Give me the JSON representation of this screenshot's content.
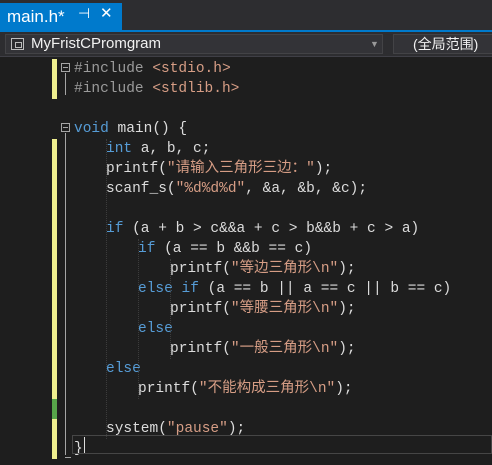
{
  "tab": {
    "title": "main.h*",
    "pin_glyph": "⊣",
    "close_glyph": "✕"
  },
  "nav": {
    "scope": "MyFristCPromgram",
    "member": "(全局范围)"
  },
  "code": [
    {
      "indent": 0,
      "fold": true,
      "change": "unsaved",
      "tokens": [
        [
          "p",
          "#include "
        ],
        [
          "i",
          "<stdio.h>"
        ]
      ]
    },
    {
      "indent": 0,
      "fold": false,
      "change": "unsaved",
      "tokens": [
        [
          "p",
          "#include "
        ],
        [
          "i",
          "<stdlib.h>"
        ]
      ]
    },
    {
      "indent": 0,
      "fold": false,
      "change": "none",
      "tokens": []
    },
    {
      "indent": 0,
      "fold": true,
      "change": "none",
      "tokens": [
        [
          "k",
          "void"
        ],
        [
          "f",
          " main() {"
        ]
      ]
    },
    {
      "indent": 1,
      "fold": false,
      "change": "unsaved",
      "tokens": [
        [
          "k",
          "int"
        ],
        [
          "f",
          " a, b, c;"
        ]
      ]
    },
    {
      "indent": 1,
      "fold": false,
      "change": "unsaved",
      "tokens": [
        [
          "f",
          "printf("
        ],
        [
          "s",
          "\"请输入三角形三边：\""
        ],
        [
          "f",
          ");"
        ]
      ]
    },
    {
      "indent": 1,
      "fold": false,
      "change": "unsaved",
      "tokens": [
        [
          "f",
          "scanf_s("
        ],
        [
          "s",
          "\"%d%d%d\""
        ],
        [
          "f",
          ", &a, &b, &c);"
        ]
      ]
    },
    {
      "indent": 0,
      "fold": false,
      "change": "unsaved",
      "tokens": []
    },
    {
      "indent": 1,
      "fold": false,
      "change": "unsaved",
      "tokens": [
        [
          "k",
          "if"
        ],
        [
          "f",
          " (a + b > c&&a + c > b&&b + c > a)"
        ]
      ]
    },
    {
      "indent": 2,
      "fold": false,
      "change": "unsaved",
      "tokens": [
        [
          "k",
          "if"
        ],
        [
          "f",
          " (a == b &&b == c)"
        ]
      ]
    },
    {
      "indent": 3,
      "fold": false,
      "change": "unsaved",
      "tokens": [
        [
          "f",
          "printf("
        ],
        [
          "s",
          "\"等边三角形\\n\""
        ],
        [
          "f",
          ");"
        ]
      ]
    },
    {
      "indent": 2,
      "fold": false,
      "change": "unsaved",
      "tokens": [
        [
          "k",
          "else if"
        ],
        [
          "f",
          " (a == b || a == c || b == c)"
        ]
      ]
    },
    {
      "indent": 3,
      "fold": false,
      "change": "unsaved",
      "tokens": [
        [
          "f",
          "printf("
        ],
        [
          "s",
          "\"等腰三角形\\n\""
        ],
        [
          "f",
          ");"
        ]
      ]
    },
    {
      "indent": 2,
      "fold": false,
      "change": "unsaved",
      "tokens": [
        [
          "k",
          "else"
        ]
      ]
    },
    {
      "indent": 3,
      "fold": false,
      "change": "unsaved",
      "tokens": [
        [
          "f",
          "printf("
        ],
        [
          "s",
          "\"一般三角形\\n\""
        ],
        [
          "f",
          ");"
        ]
      ]
    },
    {
      "indent": 1,
      "fold": false,
      "change": "unsaved",
      "tokens": [
        [
          "k",
          "else"
        ]
      ]
    },
    {
      "indent": 2,
      "fold": false,
      "change": "unsaved",
      "tokens": [
        [
          "f",
          "printf("
        ],
        [
          "s",
          "\"不能构成三角形\\n\""
        ],
        [
          "f",
          ");"
        ]
      ]
    },
    {
      "indent": 0,
      "fold": false,
      "change": "saved",
      "tokens": []
    },
    {
      "indent": 1,
      "fold": false,
      "change": "unsaved",
      "tokens": [
        [
          "f",
          "system("
        ],
        [
          "s",
          "\"pause\""
        ],
        [
          "f",
          ");"
        ]
      ]
    },
    {
      "indent": 0,
      "fold": false,
      "change": "unsaved",
      "tokens": [
        [
          "f",
          "}"
        ]
      ]
    }
  ]
}
